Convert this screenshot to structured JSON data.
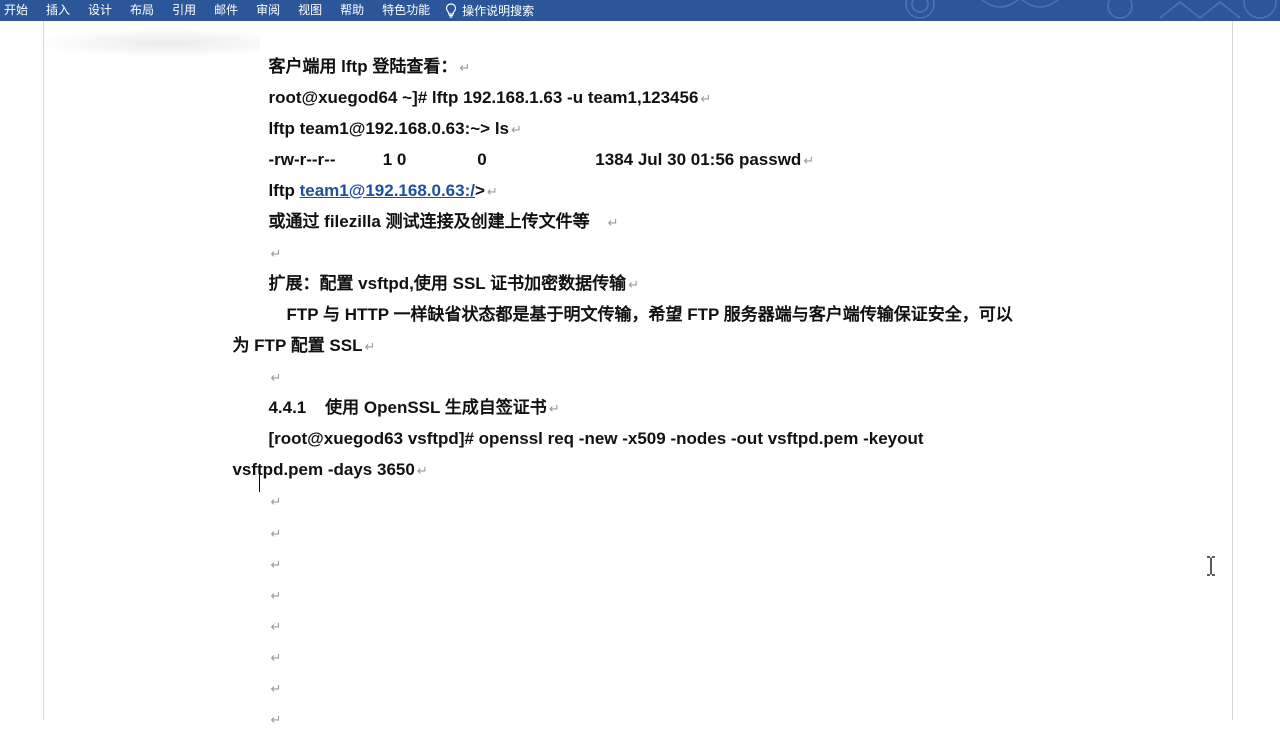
{
  "ribbon": {
    "tabs": [
      "开始",
      "插入",
      "设计",
      "布局",
      "引用",
      "邮件",
      "审阅",
      "视图",
      "帮助",
      "特色功能"
    ],
    "tell_me_icon": "lightbulb-icon",
    "tell_me_label": "操作说明搜索",
    "background_color": "#2b579a"
  },
  "document": {
    "paragraph_mark": "↵",
    "lines": {
      "l1": "客户端用 lftp 登陆查看：",
      "l2": "root@xuegod64 ~]# lftp 192.168.1.63 -u team1,123456",
      "l3": "lftp team1@192.168.0.63:~> ls",
      "l4": "-rw-r--r--          1 0               0                       1384 Jul 30 01:56 passwd",
      "l5_prefix": "lftp ",
      "l5_link": "team1@192.168.0.63:/",
      "l5_suffix": ">",
      "l6": "或通过 filezilla 测试连接及创建上传文件等",
      "l8": "扩展：配置 vsftpd,使用 SSL 证书加密数据传输",
      "l9": "FTP 与 HTTP 一样缺省状态都是基于明文传输，希望 FTP 服务器端与客户端传输保证安全，可以",
      "l10": "为 FTP 配置 SSL",
      "l12": "4.4.1    使用 OpenSSL 生成自签证书",
      "l13": "[root@xuegod63 vsftpd]# openssl req -new -x509 -nodes -out vsftpd.pem -keyout",
      "l14": "vsftpd.pem -days 3650"
    }
  }
}
